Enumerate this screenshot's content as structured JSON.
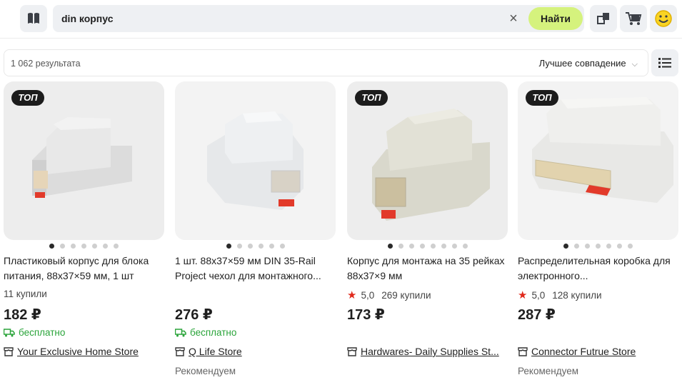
{
  "header": {
    "search_value": "din корпус",
    "clear_symbol": "×",
    "find_label": "Найти"
  },
  "results": {
    "count": "1 062 результата",
    "sort_label": "Лучшее совпадение"
  },
  "products": [
    {
      "badge": "ТОП",
      "title": "Пластиковый корпус для блока питания, 88x37×59 мм, 1 шт",
      "rating": "",
      "bought": "11 купили",
      "price": "182 ₽",
      "delivery": "бесплатно",
      "store": "Your Exclusive Home Store",
      "recommended": ""
    },
    {
      "badge": "",
      "title": "1 шт. 88x37×59 мм DIN 35-Rail Project чехол для монтажного...",
      "rating": "",
      "bought": "",
      "price": "276 ₽",
      "delivery": "бесплатно",
      "store": "Q Life Store",
      "recommended": "Рекомендуем"
    },
    {
      "badge": "ТОП",
      "title": "Корпус для монтажа на 35 рейках 88x37×9 мм",
      "rating": "5,0",
      "bought": "269 купили",
      "price": "173 ₽",
      "delivery": "",
      "store": "Hardwares- Daily Supplies St...",
      "recommended": ""
    },
    {
      "badge": "ТОП",
      "title": "Распределительная коробка для электронного...",
      "rating": "5,0",
      "bought": "128 купили",
      "price": "287 ₽",
      "delivery": "",
      "store": "Connector Futrue Store",
      "recommended": "Рекомендуем"
    }
  ],
  "colors": {
    "accent_button": "#d5f27d",
    "delivery_green": "#2aa43a",
    "star_red": "#e0291b",
    "badge_bg": "#1c1c1c"
  }
}
